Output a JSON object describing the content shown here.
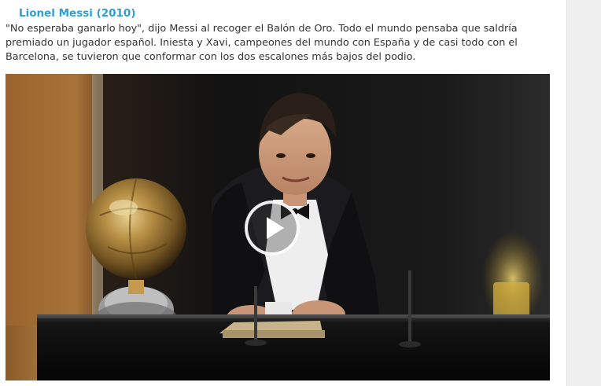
{
  "article": {
    "title": "Lionel Messi (2010)",
    "intro": "\"No esperaba ganarlo hoy\", dijo Messi al recoger el Balón de Oro. Todo el mundo pensaba que saldría premiado un jugador español. Iniesta y Xavi, campeones del mundo con España y de casi todo con el Barcelona, se tuvieron que conformar con los dos escalones más bajos del podio."
  },
  "video": {
    "play_icon": "play-icon"
  },
  "colors": {
    "title": "#2e9fd0",
    "body_text": "#333333",
    "page_background": "#ffffff",
    "gutter": "#efefef"
  }
}
